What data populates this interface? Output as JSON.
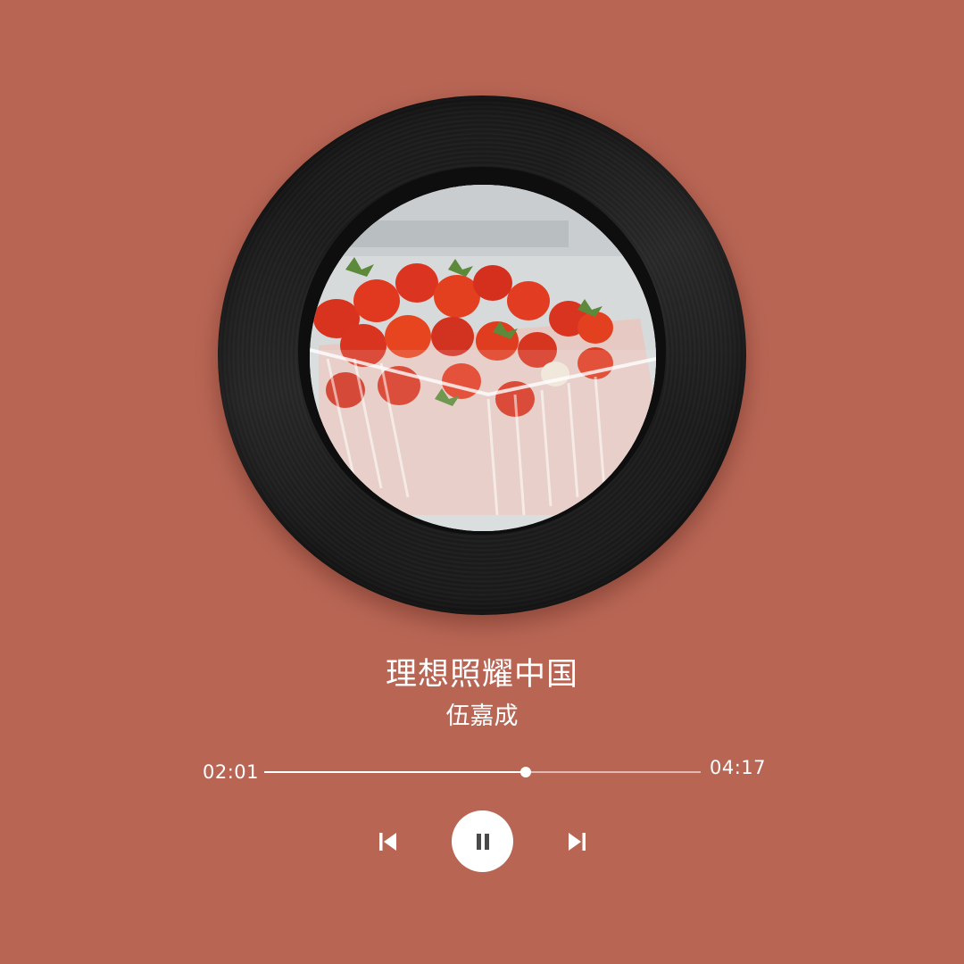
{
  "player": {
    "song_title": "理想照耀中国",
    "artist": "伍嘉成",
    "current_time": "02:01",
    "total_time": "04:17",
    "progress": 0.6
  },
  "controls": {
    "prev_icon": "skip-previous-icon",
    "play_pause_icon": "pause-icon",
    "next_icon": "skip-next-icon"
  },
  "colors": {
    "background": "#b86554",
    "vinyl": "#1c1c1c",
    "accent": "#ffffff",
    "play_icon": "#4a4a4a"
  }
}
